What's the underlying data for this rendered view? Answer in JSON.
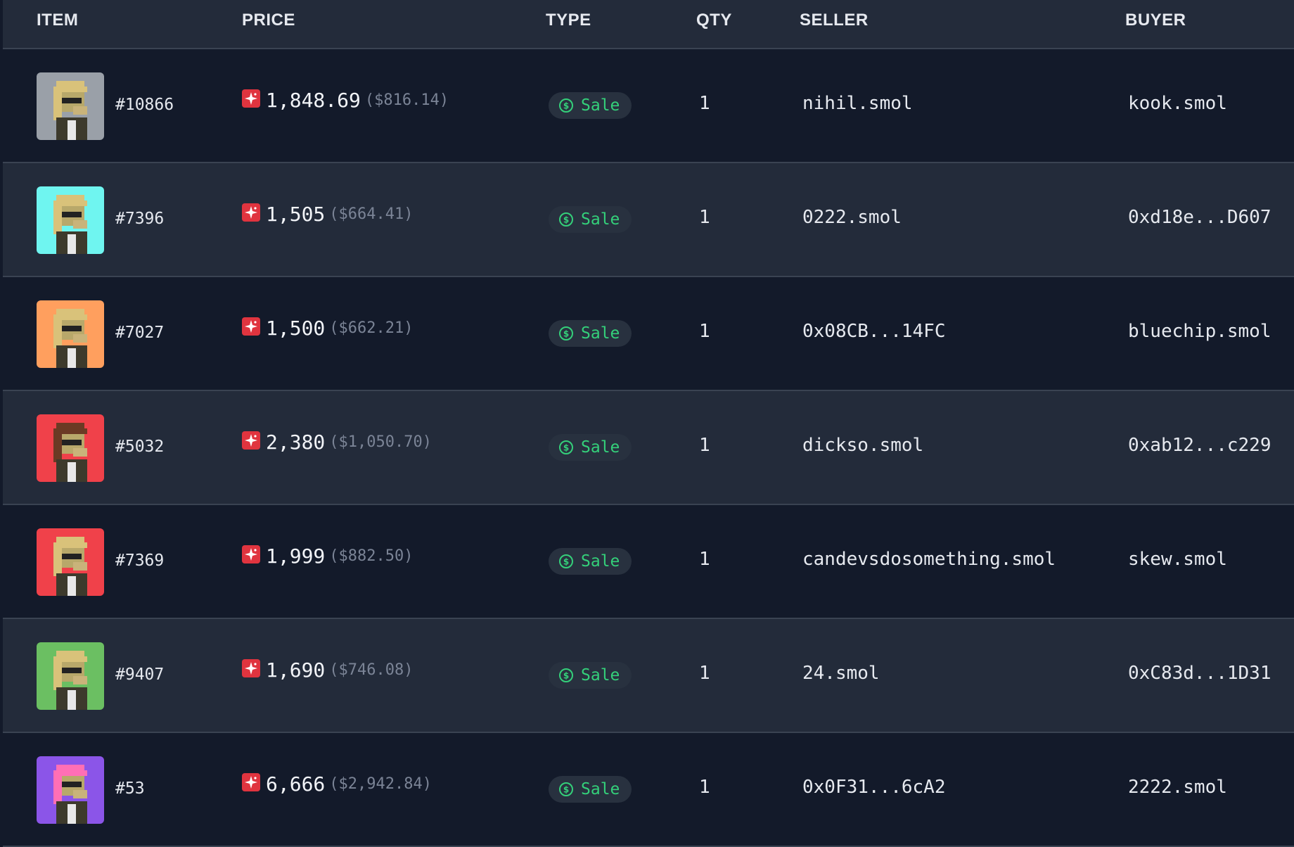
{
  "columns": {
    "item": "ITEM",
    "price": "PRICE",
    "type": "TYPE",
    "qty": "QTY",
    "seller": "SELLER",
    "buyer": "BUYER"
  },
  "colors": {
    "sale_green": "#34d07a",
    "magic_red": "#e0343f"
  },
  "rows": [
    {
      "id": "#10866",
      "price": "1,848.69",
      "usd": "($816.14)",
      "type": "Sale",
      "qty": "1",
      "seller": "nihil.smol",
      "buyer": "kook.smol",
      "avatar_bg": "#9aa0a8"
    },
    {
      "id": "#7396",
      "price": "1,505",
      "usd": "($664.41)",
      "type": "Sale",
      "qty": "1",
      "seller": "0222.smol",
      "buyer": "0xd18e...D607",
      "avatar_bg": "#6ff5f0"
    },
    {
      "id": "#7027",
      "price": "1,500",
      "usd": "($662.21)",
      "type": "Sale",
      "qty": "1",
      "seller": "0x08CB...14FC",
      "buyer": "bluechip.smol",
      "avatar_bg": "#ff9f5e"
    },
    {
      "id": "#5032",
      "price": "2,380",
      "usd": "($1,050.70)",
      "type": "Sale",
      "qty": "1",
      "seller": "dickso.smol",
      "buyer": "0xab12...c229",
      "avatar_bg": "#f0414a"
    },
    {
      "id": "#7369",
      "price": "1,999",
      "usd": "($882.50)",
      "type": "Sale",
      "qty": "1",
      "seller": "candevsdosomething.smol",
      "buyer": "skew.smol",
      "avatar_bg": "#f0414a"
    },
    {
      "id": "#9407",
      "price": "1,690",
      "usd": "($746.08)",
      "type": "Sale",
      "qty": "1",
      "seller": "24.smol",
      "buyer": "0xC83d...1D31",
      "avatar_bg": "#6bbf62"
    },
    {
      "id": "#53",
      "price": "6,666",
      "usd": "($2,942.84)",
      "type": "Sale",
      "qty": "1",
      "seller": "0x0F31...6cA2",
      "buyer": "2222.smol",
      "avatar_bg": "#8b55e8"
    }
  ]
}
